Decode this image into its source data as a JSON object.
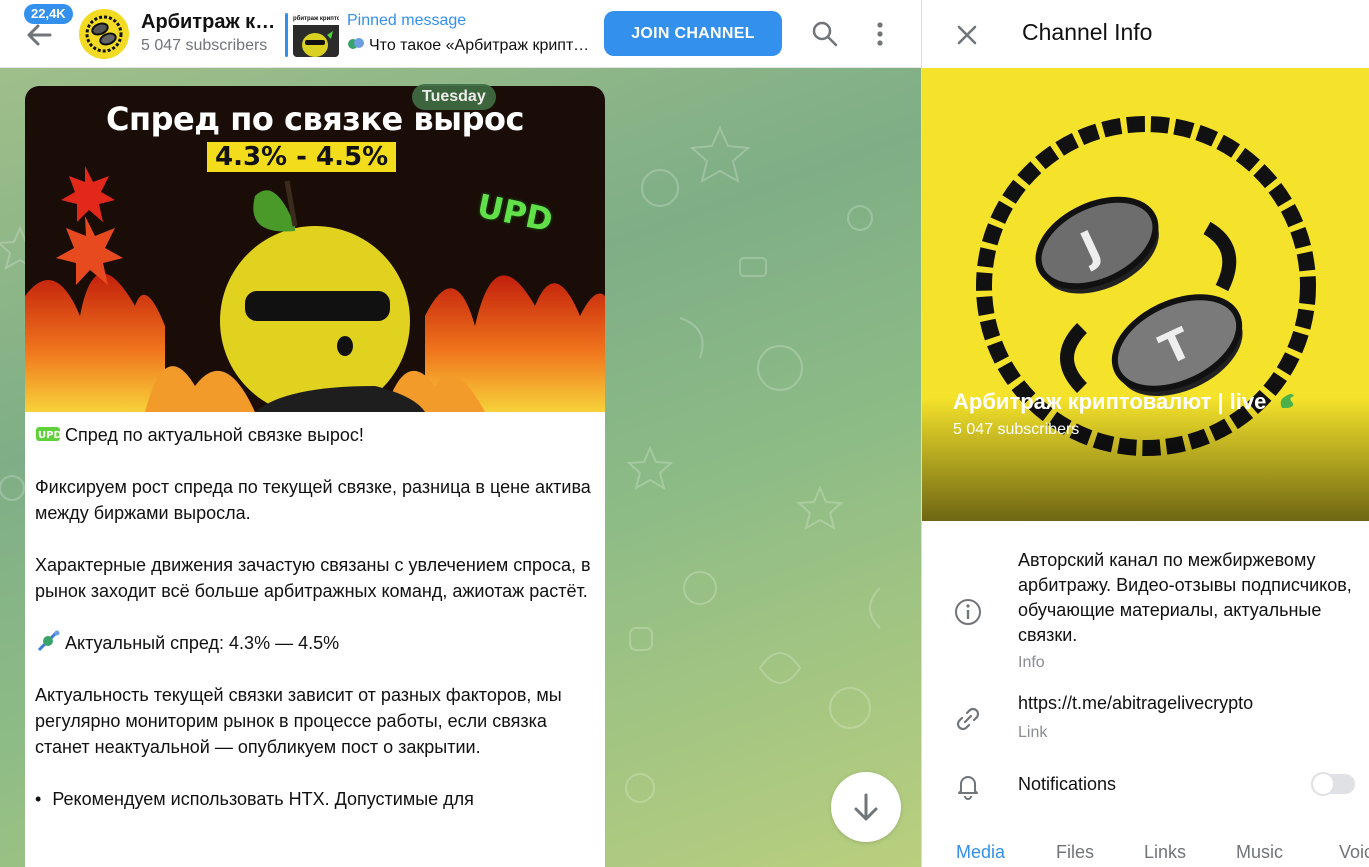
{
  "header": {
    "unread_count": "22,4K",
    "channel_title": "Арбитраж криптовалют | live",
    "subscribers": "5 047 subscribers",
    "pinned_label": "Pinned message",
    "pinned_text": "Что такое «Арбитраж криптовалют»",
    "pinned_thumb_caption": "рбитраж криптов",
    "join_label": "JOIN CHANNEL"
  },
  "chat": {
    "day_label": "Tuesday",
    "post": {
      "image_headline": "Спред по связке вырос",
      "image_range": "4.3% - 4.5%",
      "image_badge": "UPD",
      "title": "Спред по актуальной связке вырос!",
      "p1": "Фиксируем рост спреда по текущей связке, разница в цене актива между биржами выросла.",
      "p2": "Характерные движения зачастую связаны с увлечением спроса, в рынок заходит всё больше арбитражных команд, ажиотаж растёт.",
      "spread_label": "Актуальный спред:",
      "spread_value": "4.3% — 4.5%",
      "p3": "Актуальность текущей связки зависит от разных факторов, мы регулярно мониторим рынок в процессе работы, если связка станет неактуальной — опубликуем пост о закрытии.",
      "bullet1": "Рекомендуем использовать HTX. Допустимые для"
    }
  },
  "info": {
    "title": "Channel Info",
    "channel_name": "Арбитраж криптовалют | live",
    "subscribers": "5 047 subscribers",
    "description": "Авторский канал по межбиржевому арбитражу. Видео-отзывы подписчиков, обучающие материалы, актуальные связки.",
    "description_caption": "Info",
    "link": "https://t.me/abitragelivecrypto",
    "link_caption": "Link",
    "notifications_label": "Notifications",
    "notifications_on": false,
    "tabs": [
      "Media",
      "Files",
      "Links",
      "Music",
      "Voice"
    ],
    "active_tab": "Media"
  },
  "colors": {
    "accent": "#3390ec",
    "avatar_yellow": "#f2db22",
    "wallpaper_green": "#8ebc86"
  },
  "icons": [
    "back-arrow-icon",
    "search-icon",
    "more-vertical-icon",
    "close-icon",
    "info-icon",
    "link-icon",
    "bell-icon",
    "arrow-down-icon"
  ]
}
